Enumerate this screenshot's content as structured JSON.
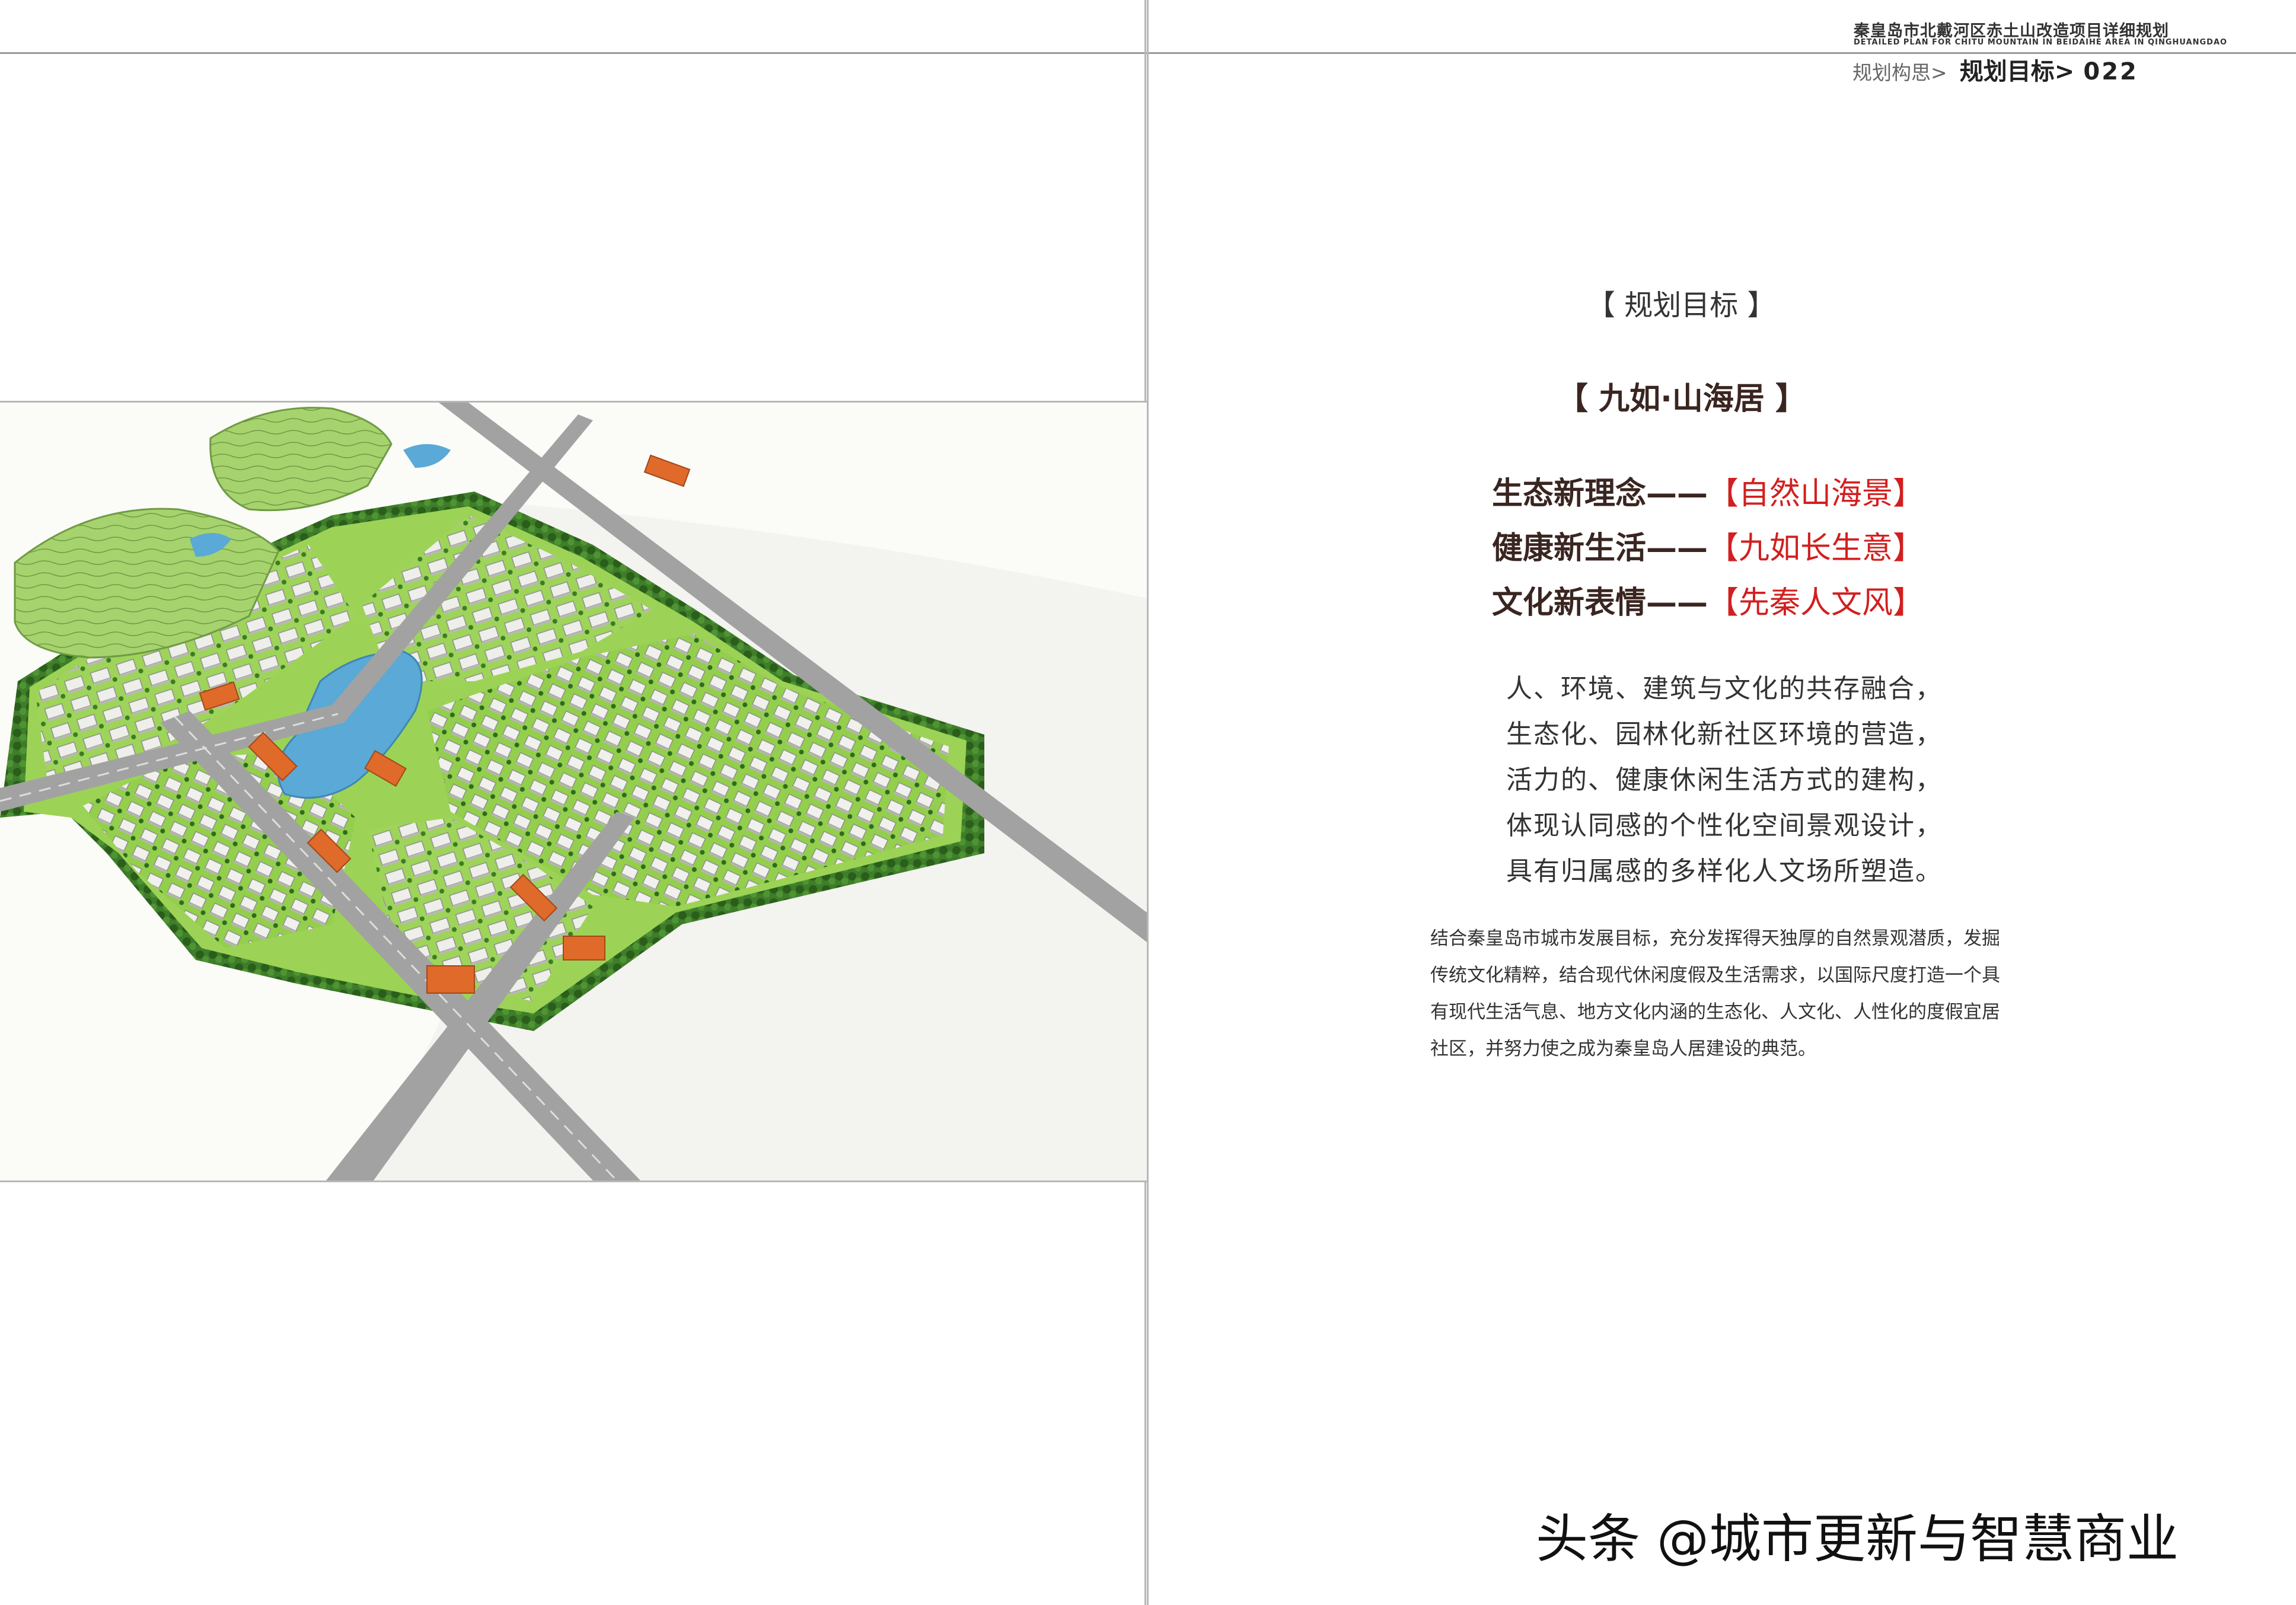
{
  "header": {
    "project_cn": "秦皇岛市北戴河区赤土山改造项目详细规划",
    "project_en": "DETAILED PLAN FOR CHITU MOUNTAIN IN BEIDAIHE AREA IN QINGHUANGDAO",
    "breadcrumb_parent": "规划构思>",
    "breadcrumb_current": "规划目标>",
    "page_number": "022"
  },
  "section": {
    "title": "【 规划目标 】",
    "slogan": "【   九如·山海居   】"
  },
  "goals": [
    {
      "key": "生态新理念",
      "dash": "——",
      "value": "【自然山海景】"
    },
    {
      "key": "健康新生活",
      "dash": "——",
      "value": "【九如长生意】"
    },
    {
      "key": "文化新表情",
      "dash": "——",
      "value": "【先秦人文风】"
    }
  ],
  "principles": [
    "人、环境、建筑与文化的共存融合，",
    "生态化、园林化新社区环境的营造，",
    "活力的、健康休闲生活方式的建构，",
    "体现认同感的个性化空间景观设计，",
    "具有归属感的多样化人文场所塑造。"
  ],
  "description": "结合秦皇岛市城市发展目标，充分发挥得天独厚的自然景观潜质，发掘传统文化精粹，结合现代休闲度假及生活需求，以国际尺度打造一个具有现代生活气息、地方文化内涵的生态化、人文化、人性化的度假宜居社区，并努力使之成为秦皇岛人居建设的典范。",
  "watermark": "头条 @城市更新与智慧商业",
  "colors": {
    "goal_value": "#d21f1f",
    "goal_key": "#3a2520",
    "grass": "#8fd14f",
    "hill": "#9ccc64",
    "road": "#9a9a9a",
    "water": "#5aa9d6",
    "roof_orange": "#e06a2a",
    "building": "#e9e9e6",
    "tree": "#2f6b1f"
  }
}
